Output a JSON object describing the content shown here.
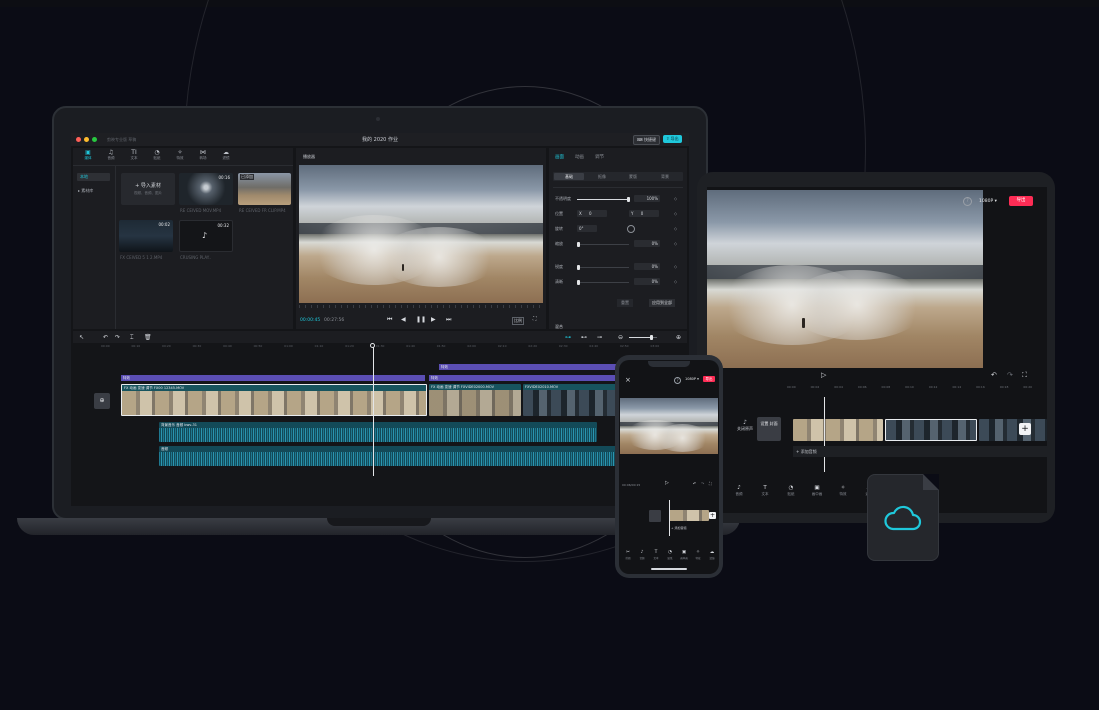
{
  "colors": {
    "accent": "#1fc8db",
    "export_red": "#fe2c55",
    "clip_purple": "#5b4eb4",
    "audio_teal": "#157a8f",
    "background": "#0b0c15"
  },
  "desktop": {
    "window_title": "我的 2020 作业",
    "app_title": "剪映专业版 草稿",
    "header_buttons": {
      "shortcuts": "快捷键",
      "export": "导出"
    },
    "toolbar": [
      {
        "icon": "media-icon",
        "label": "媒体"
      },
      {
        "icon": "audio-icon",
        "label": "音频"
      },
      {
        "icon": "text-icon",
        "label": "文本"
      },
      {
        "icon": "sticker-icon",
        "label": "贴纸"
      },
      {
        "icon": "effects-icon",
        "label": "特效"
      },
      {
        "icon": "transition-icon",
        "label": "转场"
      },
      {
        "icon": "filter-icon",
        "label": "滤镜"
      }
    ],
    "media_sidebar": {
      "local": "本地",
      "library": "▸ 素材库"
    },
    "import_button": {
      "label": "导入素材",
      "hint": "视频、音频、图片"
    },
    "media_items": [
      {
        "name": "RE CEIVED MOV.MP4",
        "duration": "00:16",
        "style": "tunnel"
      },
      {
        "name": "RE CEIVED FR CLIP.MP4",
        "duration": "",
        "badge": "已添加",
        "style": "landscape"
      },
      {
        "name": "FX CEIVED 5 1 2.MP4",
        "duration": "00:02",
        "style": "dark"
      },
      {
        "name": "CRUSING PLAY..",
        "duration": "00:32",
        "style": "tiktok"
      }
    ],
    "player": {
      "title": "播放器",
      "current_time": "00:00:45",
      "total_time": "00:27:56",
      "ratio": "比例"
    },
    "inspector": {
      "tabs": [
        "画面",
        "动画",
        "调节"
      ],
      "subtabs": [
        "基础",
        "抠像",
        "蒙版",
        "背景"
      ],
      "rows": [
        {
          "label": "不透明度",
          "value": "100%"
        },
        {
          "label": "位置",
          "x": "0",
          "y": "0"
        },
        {
          "label": "旋转",
          "value": "0°"
        },
        {
          "label": "缩放",
          "value": "0%"
        },
        {
          "label": "锐度",
          "value": "0%"
        },
        {
          "label": "清晰",
          "value": "0%"
        }
      ],
      "reset_button": "重置",
      "apply_all_button": "应用到全部",
      "footer_label": "混合"
    },
    "timeline": {
      "ruler": [
        "00:00",
        "00:10",
        "00:20",
        "00:30",
        "00:40",
        "00:50",
        "01:00",
        "01:10",
        "01:20",
        "01:30",
        "01:40",
        "01:50",
        "02:00",
        "02:10",
        "02:20",
        "02:30",
        "02:40",
        "02:50",
        "03:00"
      ],
      "labels": {
        "effect_top": "特效",
        "effect_a": "特效",
        "effect_b": "特效",
        "clip_a": "FX 动画 变速 调节 FX00 12345.MOV",
        "clip_b": "FX 动画 变速 调节 FXVIDE02000.MOV",
        "clip_c": "FXVIDE02010.MOV",
        "audio_a": "背景音乐 音频 bwv-31",
        "audio_b": "音频"
      }
    }
  },
  "tablet": {
    "resolution": "1080P ▾",
    "export_label": "导出",
    "ruler": [
      "00:00",
      "00:02",
      "00:04",
      "00:06",
      "00:08",
      "00:10",
      "00:12",
      "00:14",
      "00:16",
      "00:18",
      "00:20"
    ],
    "cover_label": "设置 封面",
    "mute_label": "关闭原声",
    "add_audio": "+ 添加音频",
    "bottom_tools": [
      {
        "icon": "audio-icon",
        "label": "音频"
      },
      {
        "icon": "text-icon",
        "label": "文本"
      },
      {
        "icon": "sticker-icon",
        "label": "贴纸"
      },
      {
        "icon": "canvas-icon",
        "label": "画中画"
      },
      {
        "icon": "effects-icon",
        "label": "特效"
      },
      {
        "icon": "filter-icon",
        "label": "滤镜"
      },
      {
        "icon": "adjust-icon",
        "label": "调节"
      }
    ]
  },
  "phone": {
    "resolution": "1080P ▾",
    "export_label": "导出",
    "current_time": "00:06/00:15",
    "add_audio": "+ 添加音频",
    "bottom_tools": [
      {
        "icon": "cut-icon",
        "label": "剪辑"
      },
      {
        "icon": "audio-icon",
        "label": "音频"
      },
      {
        "icon": "text-icon",
        "label": "文本"
      },
      {
        "icon": "sticker-icon",
        "label": "贴纸"
      },
      {
        "icon": "canvas-icon",
        "label": "画中画"
      },
      {
        "icon": "effects-icon",
        "label": "特效"
      },
      {
        "icon": "filter-icon",
        "label": "滤镜"
      }
    ]
  },
  "cloud_tile": {
    "icon": "cloud-icon"
  }
}
